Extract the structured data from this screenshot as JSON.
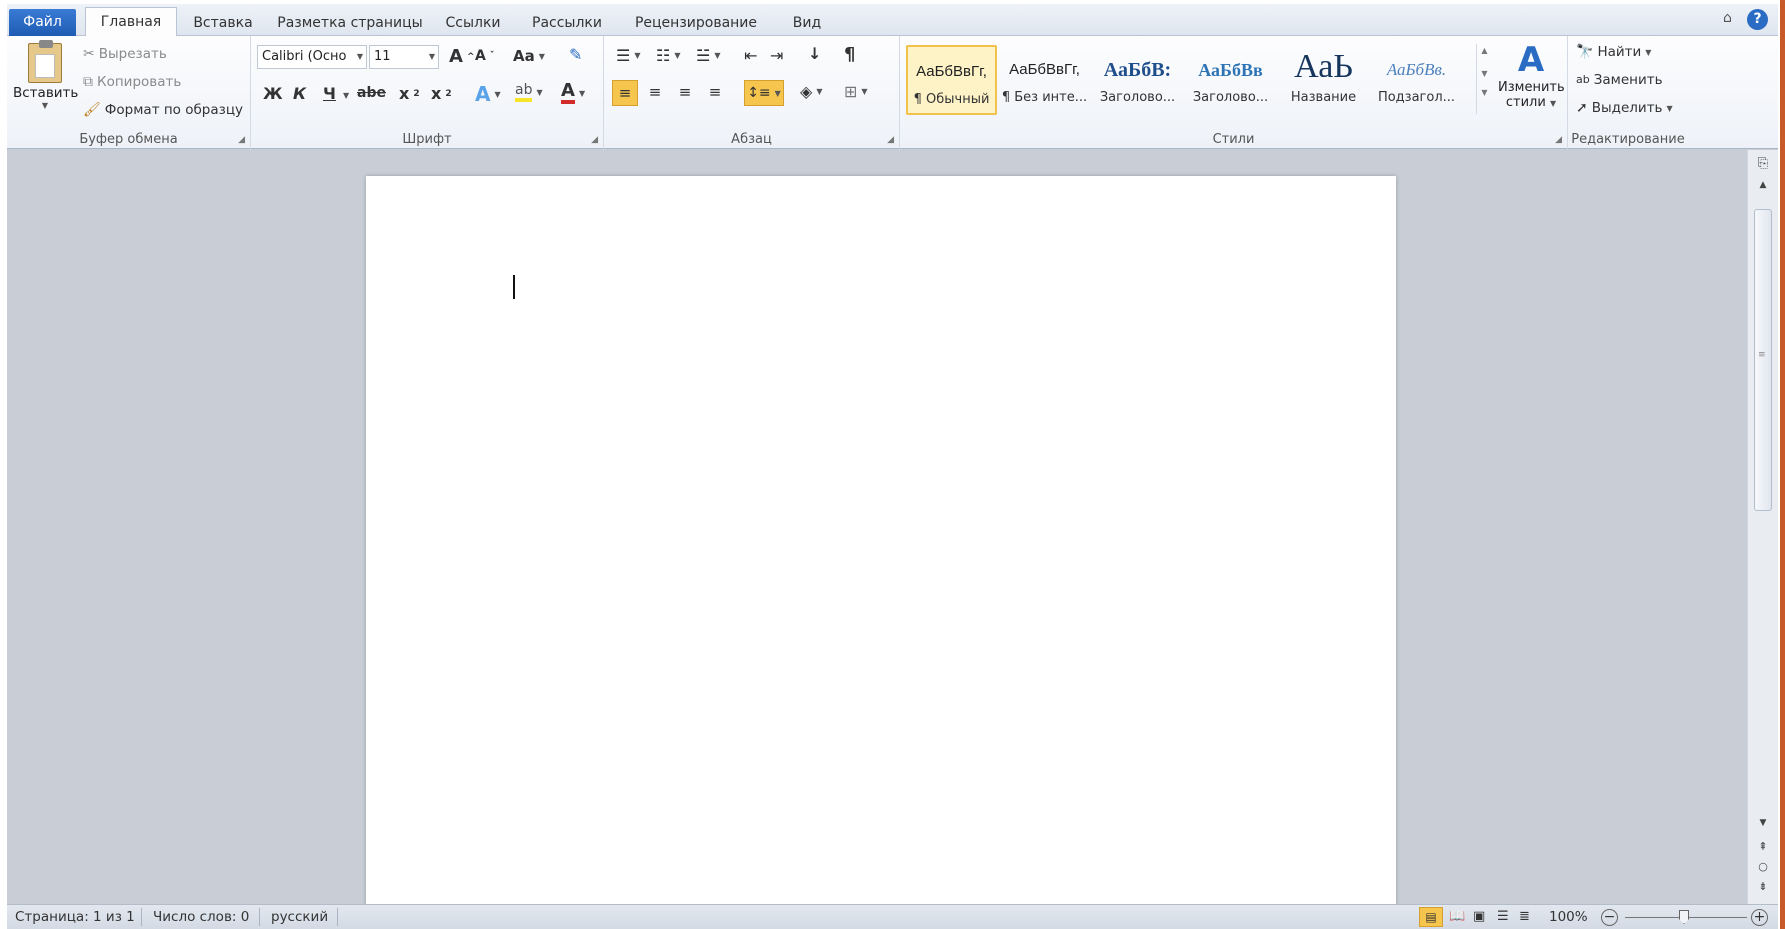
{
  "tabs": {
    "file": "Файл",
    "home": "Главная",
    "insert": "Вставка",
    "layout": "Разметка страницы",
    "references": "Ссылки",
    "mailings": "Рассылки",
    "review": "Рецензирование",
    "view": "Вид"
  },
  "clipboard": {
    "paste": "Вставить",
    "cut": "Вырезать",
    "copy": "Копировать",
    "format_painter": "Формат по образцу",
    "label": "Буфер обмена"
  },
  "font": {
    "name": "Calibri (Осно",
    "size": "11",
    "grow": "A",
    "shrink": "A",
    "case": "Aa",
    "bold": "Ж",
    "italic": "К",
    "underline": "Ч",
    "strike": "abe",
    "subscript": "x",
    "superscript": "x",
    "color_letter": "A",
    "label": "Шрифт"
  },
  "paragraph": {
    "pilcrow": "¶",
    "label": "Абзац"
  },
  "styles": {
    "items": [
      {
        "preview": "АаБбВвГг,",
        "name": "¶ Обычный"
      },
      {
        "preview": "АаБбВвГг,",
        "name": "¶ Без инте..."
      },
      {
        "preview": "АаБбВ:",
        "name": "Заголово..."
      },
      {
        "preview": "АаБбВв",
        "name": "Заголово..."
      },
      {
        "preview": "АаЬ",
        "name": "Название"
      },
      {
        "preview": "АаБбВв.",
        "name": "Подзагол..."
      }
    ],
    "change": "Изменить",
    "change2": "стили",
    "label": "Стили"
  },
  "editing": {
    "find": "Найти",
    "replace": "Заменить",
    "select": "Выделить",
    "label": "Редактирование"
  },
  "status": {
    "page": "Страница: 1 из 1",
    "words": "Число слов: 0",
    "language": "русский",
    "zoom": "100%"
  },
  "colors": {
    "file_tab": "#2a6bc4",
    "accent_highlight": "#f6c54d",
    "font_color": "#d22b2b",
    "title_style": "#17365d",
    "heading_style": "#2e74b5"
  }
}
